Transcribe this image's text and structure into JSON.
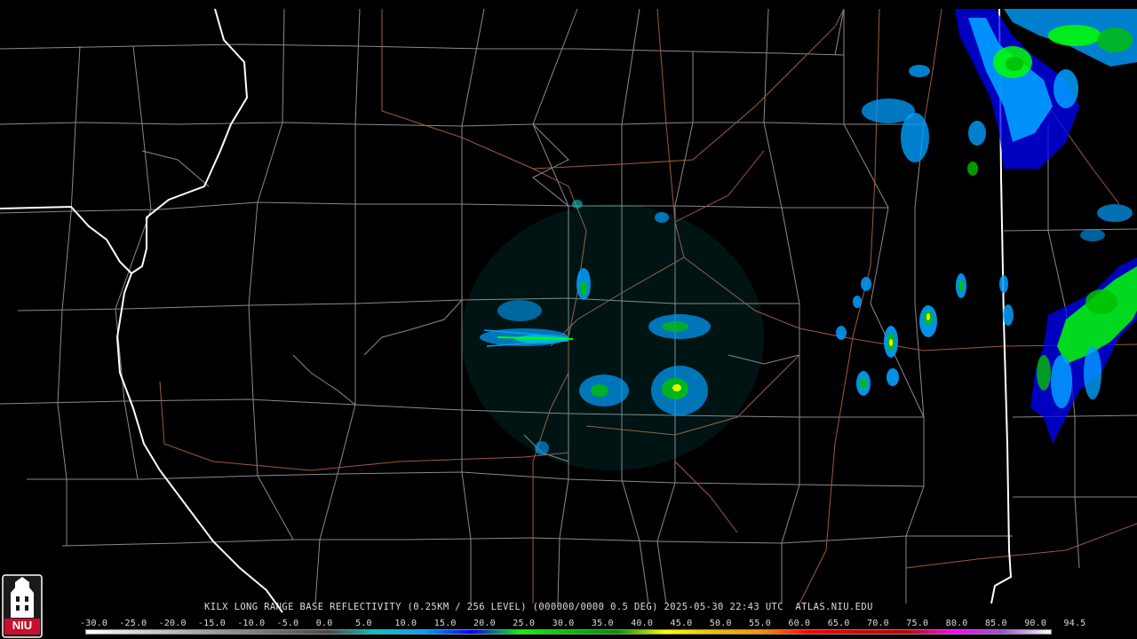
{
  "product": {
    "caption": "KILX LONG RANGE BASE REFLECTIVITY (0.25KM / 256 LEVEL) (000000/0000 0.5 DEG) 2025-05-30 22:43 UTC  ATLAS.NIU.EDU"
  },
  "legend": {
    "scale_labels": [
      "-30.0",
      "-25.0",
      "-20.0",
      "-15.0",
      "-10.0",
      "-5.0",
      "0.0",
      "5.0",
      "10.0",
      "15.0",
      "20.0",
      "25.0",
      "30.0",
      "35.0",
      "40.0",
      "45.0",
      "50.0",
      "55.0",
      "60.0",
      "65.0",
      "70.0",
      "75.0",
      "80.0",
      "85.0",
      "90.0",
      "94.5"
    ],
    "colors": [
      "#ffffff",
      "#d8d8d8",
      "#b4b4b4",
      "#909090",
      "#6c6c6c",
      "#484848",
      "#00c8c8",
      "#00a0ff",
      "#0000ff",
      "#00ff00",
      "#00c000",
      "#009000",
      "#ffff00",
      "#e7c000",
      "#ff9000",
      "#ff0000",
      "#d60000",
      "#c00000",
      "#ff00ff",
      "#9955c9",
      "#ffffff"
    ]
  },
  "logo": {
    "text": "NIU",
    "color": "#c8102e"
  },
  "colors": {
    "background": "#000000",
    "county_lines": "#8a8a8a",
    "state_lines": "#ffffff",
    "highways": "#a05a3c"
  }
}
